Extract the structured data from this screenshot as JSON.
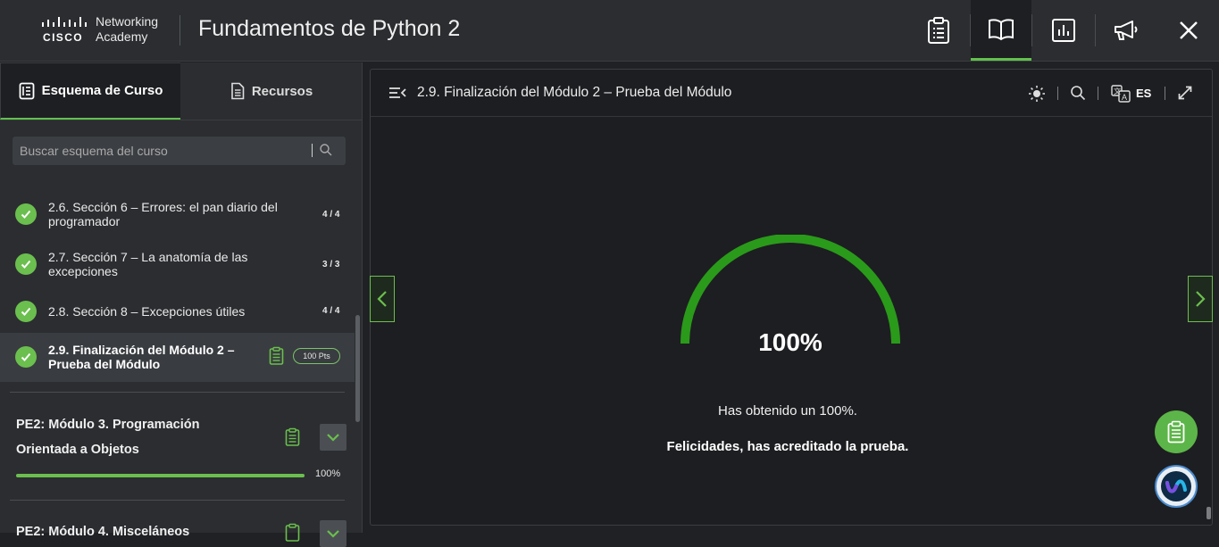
{
  "brand": {
    "logo_word": "CISCO",
    "logo_subtitle_line1": "Networking",
    "logo_subtitle_line2": "Academy",
    "course_title": "Fundamentos de Python 2"
  },
  "header_icons": [
    "clipboard-icon",
    "book-icon",
    "bar-chart-icon",
    "megaphone-icon",
    "close-icon"
  ],
  "tabs": [
    {
      "label": "Esquema de Curso",
      "icon": "outline-icon",
      "active": true
    },
    {
      "label": "Recursos",
      "icon": "document-icon",
      "active": false
    }
  ],
  "search": {
    "placeholder": "Buscar esquema del curso"
  },
  "outline": [
    {
      "label": "2.6. Sección 6 – Errores: el pan diario del programador",
      "count": "4 / 4"
    },
    {
      "label": "2.7. Sección 7 – La anatomía de las excepciones",
      "count": "3 / 3"
    },
    {
      "label": "2.8. Sección 8 – Excepciones útiles",
      "count": "4 / 4"
    },
    {
      "label": "2.9. Finalización del Módulo 2 – Prueba del Módulo",
      "badge": "100 Pts",
      "current": true
    }
  ],
  "modules": [
    {
      "title": "PE2: Módulo 3. Programación Orientada a Objetos",
      "progress": 100,
      "progress_label": "100%"
    },
    {
      "title": "PE2: Módulo 4. Misceláneos"
    }
  ],
  "content": {
    "title": "2.9. Finalización del Módulo 2 – Prueba del Módulo",
    "language": "ES",
    "score": 100,
    "score_label": "100%",
    "result_text": "Has obtenido un 100%.",
    "congrats_text": "Felicidades, has acreditado la prueba."
  },
  "colors": {
    "accent": "#62c14d",
    "gauge": "#2a9a1a",
    "background": "#1f2124",
    "panel": "#2b2d30"
  }
}
